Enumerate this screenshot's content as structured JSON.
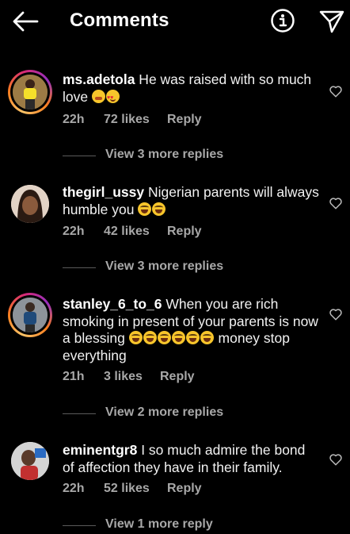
{
  "header": {
    "title": "Comments",
    "back_icon": "back-arrow-icon",
    "info_icon": "info-icon",
    "send_icon": "send-icon"
  },
  "comments": [
    {
      "username": "ms.adetola",
      "text": " He was raised with so much love ",
      "emojis": [
        "shy-smile",
        "heart-eyes"
      ],
      "time": "22h",
      "likes": "72 likes",
      "reply": "Reply",
      "view_more": "View 3 more replies",
      "has_story": true
    },
    {
      "username": "thegirl_ussy",
      "text": " Nigerian parents will always humble you ",
      "emojis": [
        "joy",
        "joy"
      ],
      "time": "22h",
      "likes": "42 likes",
      "reply": "Reply",
      "view_more": "View 3 more replies",
      "has_story": false
    },
    {
      "username": "stanley_6_to_6",
      "text": " When you are rich smoking in present of your parents is now a blessing ",
      "emojis": [
        "joy",
        "joy",
        "joy",
        "joy",
        "joy",
        "joy"
      ],
      "text_after": " money stop everything",
      "time": "21h",
      "likes": "3 likes",
      "reply": "Reply",
      "view_more": "View 2 more replies",
      "has_story": true
    },
    {
      "username": "eminentgr8",
      "text": " I so much admire the bond of affection they have in their family.",
      "emojis": [],
      "time": "22h",
      "likes": "52 likes",
      "reply": "Reply",
      "view_more": "View 1 more reply",
      "has_story": false
    }
  ],
  "colors": {
    "background": "#000000",
    "text": "#ffffff",
    "secondary_text": "#a8a8a8",
    "story_ring": [
      "#fdc468",
      "#fa7e1e",
      "#d62976",
      "#962fbf"
    ]
  }
}
